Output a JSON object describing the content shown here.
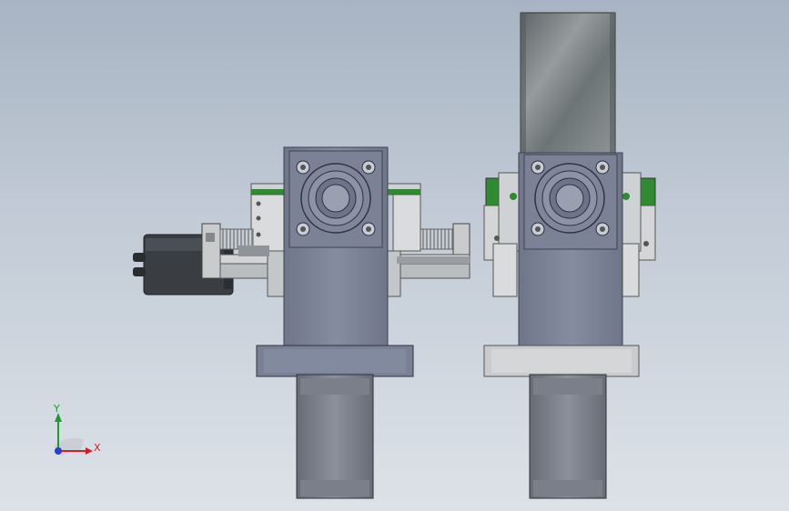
{
  "view": {
    "background_top": "#a8b4c3",
    "background_bottom": "#dde2e8"
  },
  "triad": {
    "x_label": "X",
    "y_label": "Y",
    "x_color": "#d2202a",
    "y_color": "#1f9a2e",
    "z_color": "#2a3fd0"
  },
  "colors": {
    "housing": "#7c8398",
    "housing_dark": "#60677a",
    "plate": "#c9cbcd",
    "rail_green": "#2f8a32",
    "screw": "#b8bcc0",
    "motor": "#3a3d42",
    "glass": "#7c8486"
  }
}
